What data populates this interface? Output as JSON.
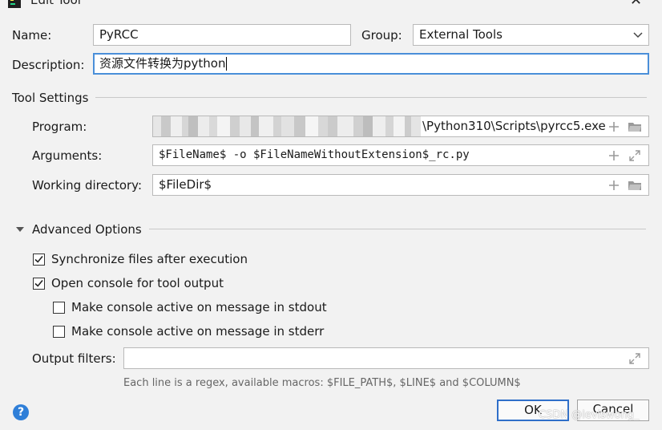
{
  "window": {
    "title": "Edit Tool",
    "close_symbol": "✕"
  },
  "form": {
    "name_label": "Name:",
    "name_value": "PyRCC",
    "group_label": "Group:",
    "group_value": "External Tools",
    "description_label": "Description:",
    "description_value": "资源文件转换为python"
  },
  "tool_settings": {
    "title": "Tool Settings",
    "program_label": "Program:",
    "program_value": "\\Python310\\Scripts\\pyrcc5.exe",
    "arguments_label": "Arguments:",
    "arguments_value": "$FileName$ -o $FileNameWithoutExtension$_rc.py",
    "working_dir_label": "Working directory:",
    "working_dir_value": "$FileDir$"
  },
  "advanced": {
    "title": "Advanced Options",
    "options": [
      {
        "label": "Synchronize files after execution",
        "checked": true
      },
      {
        "label": "Open console for tool output",
        "checked": true
      },
      {
        "label": "Make console active on message in stdout",
        "checked": false
      },
      {
        "label": "Make console active on message in stderr",
        "checked": false
      }
    ],
    "output_filters_label": "Output filters:",
    "output_filters_value": "",
    "hint": "Each line is a regex, available macros: $FILE_PATH$, $LINE$ and $COLUMN$"
  },
  "footer": {
    "help_symbol": "?",
    "ok_label": "OK",
    "cancel_label": "Cancel",
    "watermark": "CSDN @leviswong_"
  },
  "colors": {
    "accent": "#4a8fd9",
    "help": "#2f7fd8",
    "background": "#f2f2f2"
  }
}
